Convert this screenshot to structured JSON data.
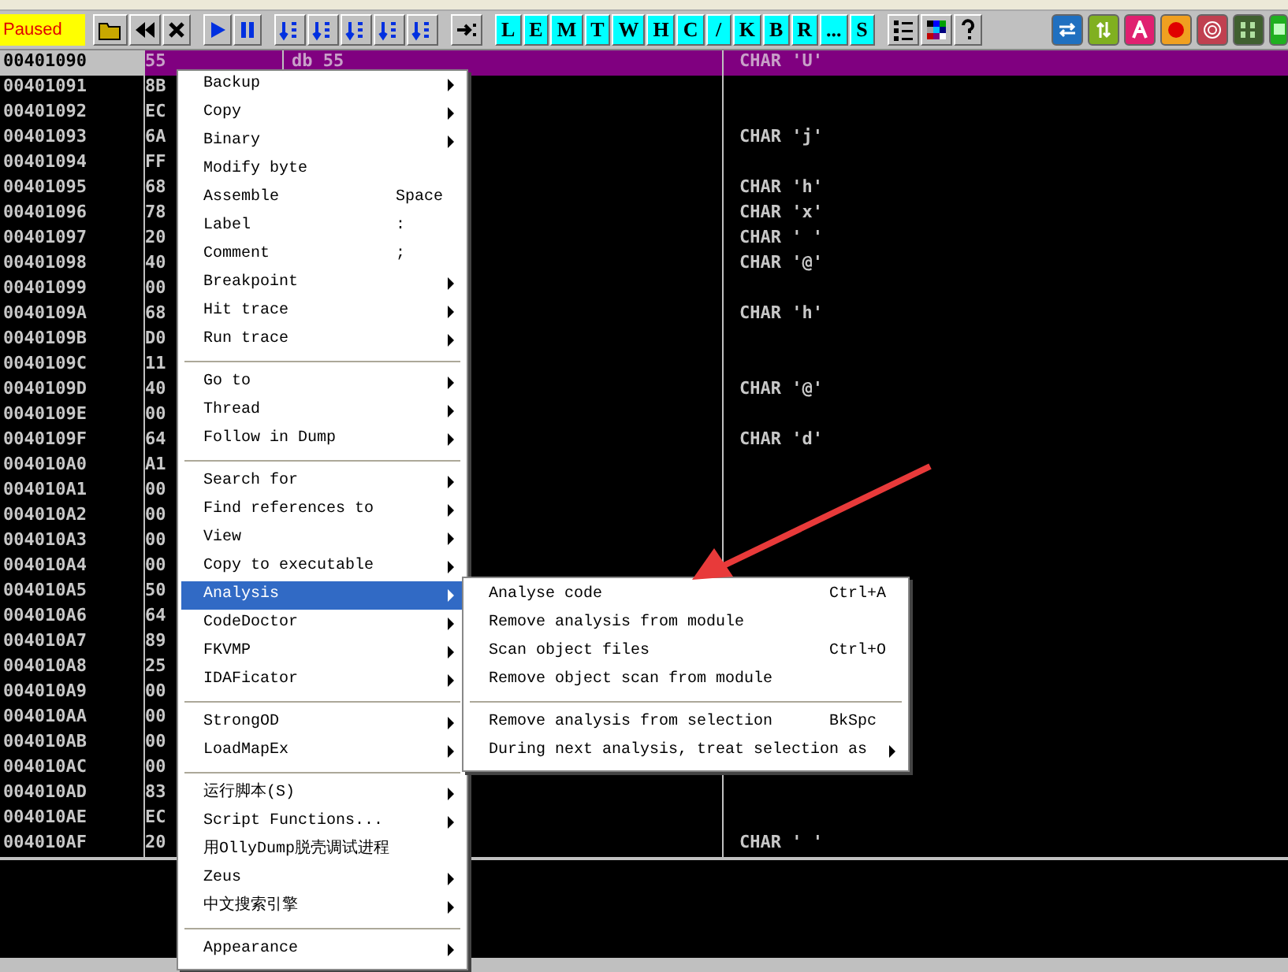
{
  "toolbar": {
    "status": "Paused",
    "letter_buttons": [
      "L",
      "E",
      "M",
      "T",
      "W",
      "H",
      "C",
      "/",
      "K",
      "B",
      "R",
      "...",
      "S"
    ]
  },
  "rows": [
    {
      "address": "00401090",
      "hex": "55",
      "disasm": "db 55",
      "comment": "CHAR 'U'",
      "selected": true
    },
    {
      "address": "00401091",
      "hex": "8B",
      "selected": false
    },
    {
      "address": "00401092",
      "hex": "EC",
      "selected": false
    },
    {
      "address": "00401093",
      "hex": "6A",
      "comment": "CHAR 'j'",
      "selected": false
    },
    {
      "address": "00401094",
      "hex": "FF",
      "selected": false
    },
    {
      "address": "00401095",
      "hex": "68",
      "comment": "CHAR 'h'",
      "selected": false
    },
    {
      "address": "00401096",
      "hex": "78",
      "comment": "CHAR 'x'",
      "selected": false
    },
    {
      "address": "00401097",
      "hex": "20",
      "comment": "CHAR ' '",
      "selected": false
    },
    {
      "address": "00401098",
      "hex": "40",
      "comment": "CHAR '@'",
      "selected": false
    },
    {
      "address": "00401099",
      "hex": "00",
      "selected": false
    },
    {
      "address": "0040109A",
      "hex": "68",
      "comment": "CHAR 'h'",
      "selected": false
    },
    {
      "address": "0040109B",
      "hex": "D0",
      "selected": false
    },
    {
      "address": "0040109C",
      "hex": "11",
      "selected": false
    },
    {
      "address": "0040109D",
      "hex": "40",
      "comment": "CHAR '@'",
      "selected": false
    },
    {
      "address": "0040109E",
      "hex": "00",
      "selected": false
    },
    {
      "address": "0040109F",
      "hex": "64",
      "comment": "CHAR 'd'",
      "selected": false
    },
    {
      "address": "004010A0",
      "hex": "A1",
      "selected": false
    },
    {
      "address": "004010A1",
      "hex": "00",
      "selected": false
    },
    {
      "address": "004010A2",
      "hex": "00",
      "selected": false
    },
    {
      "address": "004010A3",
      "hex": "00",
      "selected": false
    },
    {
      "address": "004010A4",
      "hex": "00",
      "selected": false
    },
    {
      "address": "004010A5",
      "hex": "50",
      "selected": false
    },
    {
      "address": "004010A6",
      "hex": "64",
      "selected": false
    },
    {
      "address": "004010A7",
      "hex": "89",
      "selected": false
    },
    {
      "address": "004010A8",
      "hex": "25",
      "selected": false
    },
    {
      "address": "004010A9",
      "hex": "00",
      "selected": false
    },
    {
      "address": "004010AA",
      "hex": "00",
      "selected": false
    },
    {
      "address": "004010AB",
      "hex": "00",
      "selected": false
    },
    {
      "address": "004010AC",
      "hex": "00",
      "selected": false
    },
    {
      "address": "004010AD",
      "hex": "83",
      "selected": false
    },
    {
      "address": "004010AE",
      "hex": "EC",
      "selected": false
    },
    {
      "address": "004010AF",
      "hex": "20",
      "comment": "CHAR ' '",
      "selected": false
    }
  ],
  "context_menu": {
    "groups": [
      [
        {
          "label": "Backup",
          "submenu": true,
          "selected": false
        },
        {
          "label": "Copy",
          "submenu": true,
          "selected": false
        },
        {
          "label": "Binary",
          "submenu": true,
          "selected": false
        },
        {
          "label": "Modify byte",
          "submenu": false,
          "selected": false
        },
        {
          "label": "Assemble",
          "shortcut": "Space",
          "submenu": false,
          "selected": false
        },
        {
          "label": "Label",
          "shortcut": ":",
          "submenu": false,
          "selected": false
        },
        {
          "label": "Comment",
          "shortcut": ";",
          "submenu": false,
          "selected": false
        },
        {
          "label": "Breakpoint",
          "submenu": true,
          "selected": false
        },
        {
          "label": "Hit trace",
          "submenu": true,
          "selected": false
        },
        {
          "label": "Run trace",
          "submenu": true,
          "selected": false
        }
      ],
      [
        {
          "label": "Go to",
          "submenu": true,
          "selected": false
        },
        {
          "label": "Thread",
          "submenu": true,
          "selected": false
        },
        {
          "label": "Follow in Dump",
          "submenu": true,
          "selected": false
        }
      ],
      [
        {
          "label": "Search for",
          "submenu": true,
          "selected": false
        },
        {
          "label": "Find references to",
          "submenu": true,
          "selected": false
        },
        {
          "label": "View",
          "submenu": true,
          "selected": false
        },
        {
          "label": "Copy to executable",
          "submenu": true,
          "selected": false
        },
        {
          "label": "Analysis",
          "submenu": true,
          "selected": true
        },
        {
          "label": "CodeDoctor",
          "submenu": true,
          "selected": false
        },
        {
          "label": "FKVMP",
          "submenu": true,
          "selected": false
        },
        {
          "label": "IDAFicator",
          "submenu": true,
          "selected": false
        }
      ],
      [
        {
          "label": "StrongOD",
          "submenu": true,
          "selected": false
        },
        {
          "label": "LoadMapEx",
          "submenu": true,
          "selected": false
        }
      ],
      [
        {
          "label": "运行脚本(S)",
          "submenu": true,
          "selected": false
        },
        {
          "label": "Script Functions...",
          "submenu": true,
          "selected": false
        },
        {
          "label": "用OllyDump脱壳调试进程",
          "submenu": false,
          "selected": false
        },
        {
          "label": "Zeus",
          "submenu": true,
          "selected": false
        },
        {
          "label": "中文搜索引擎",
          "submenu": true,
          "selected": false
        }
      ],
      [
        {
          "label": "Appearance",
          "submenu": true,
          "selected": false
        }
      ]
    ]
  },
  "submenu": {
    "groups": [
      [
        {
          "label": "Analyse code",
          "shortcut": "Ctrl+A",
          "submenu": false
        },
        {
          "label": "Remove analysis from module",
          "submenu": false
        },
        {
          "label": "Scan object files",
          "shortcut": "Ctrl+O",
          "submenu": false
        },
        {
          "label": "Remove object scan from module",
          "submenu": false
        }
      ],
      [
        {
          "label": "Remove analysis from selection",
          "shortcut": "BkSpc",
          "submenu": false
        },
        {
          "label": "During next analysis, treat selection as",
          "submenu": true
        }
      ]
    ]
  }
}
